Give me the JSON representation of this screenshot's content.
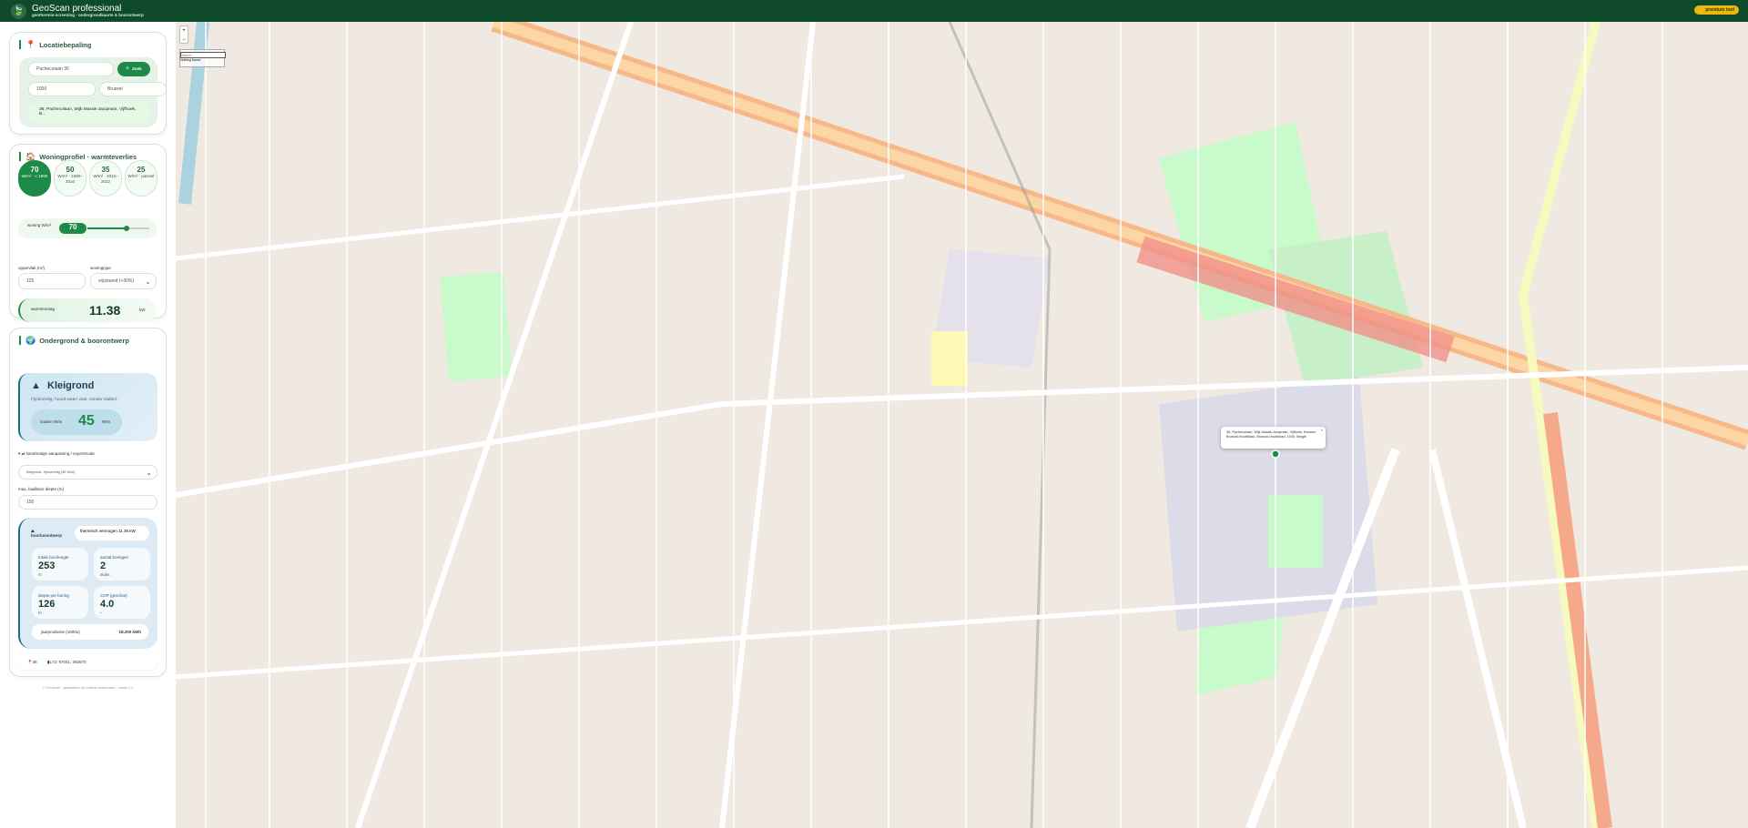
{
  "header": {
    "title": "GeoScan professional",
    "subtitle": "geothermie-screening · ondergrondkaarte & boorontwerp",
    "premium": "👑 premium tool"
  },
  "location": {
    "title": "Locatiebepaling",
    "street": "Pachecolaan 36",
    "search_label": "🔍 Zoek",
    "postcode": "1000",
    "city": "Brussel",
    "result": "36, Pachecolaan, Wijk Marais-Jacqmain, Vijfhoek, B..."
  },
  "profile": {
    "title": "Woningprofiel · warmteverlies",
    "options": [
      {
        "value": "70",
        "label": "W/m² · < 1990"
      },
      {
        "value": "50",
        "label": "W/m² · 1990–2010"
      },
      {
        "value": "35",
        "label": "W/m² · 2010–2022"
      },
      {
        "value": "25",
        "label": "W/m² · passief"
      }
    ],
    "slider_label": "woning W/m²",
    "slider_value": "70",
    "slider_fraction": 0.63,
    "area_label": "oppervlak (m²)",
    "area_value": "125",
    "type_label": "woningtype",
    "type_value": "vrijstaand (+30%)",
    "demand_label": "warmtevraag",
    "demand_value": "11.38",
    "demand_unit": "kW"
  },
  "ground": {
    "title": "Ondergrond & boorontwerp",
    "soil_name": "Kleigrond",
    "soil_desc": "Fijnkorrelig, houdt water vast, minder stabiel.",
    "bodem_label": "bodem W/m",
    "bodem_value": "45",
    "bodem_unit": "W/m",
    "expert_label": "handmatige aanpassing / expertmode",
    "soil_select": "Kleigrond - fijnkorrelig (45 W/m)",
    "depth_label": "max. haalbare diepte (m)",
    "depth_value": "150"
  },
  "design": {
    "title": "boorlusontwerp",
    "capacity": "thermisch vermogen 11.38 kW",
    "stats": [
      {
        "label": "totale boorlengte",
        "value": "253",
        "unit": "m"
      },
      {
        "label": "aantal boringen",
        "value": "2",
        "unit": "stuks"
      },
      {
        "label": "diepte per boring",
        "value": "126",
        "unit": "m"
      },
      {
        "label": "COP (geschat)",
        "value": "4.0",
        "unit": "–"
      }
    ],
    "annual_label": "jaarproductie (1600u)",
    "annual_value": "18.200 kWh"
  },
  "coords": {
    "number": "36",
    "lambert": "L72: 97041, 252570"
  },
  "footer": "© GeoScan · gebaseerd op externe bodemdata · versie 2.0",
  "map": {
    "search_placeholder": "Search...",
    "search_hint": "Nothing found.",
    "popup": "36, Pachecolaan, Wijk Marais-Jacqmain, Vijfhoek, Brussel, Brussel-Hoofdstad, Brussel-Hoofdstad, 1000, België",
    "zoom_in": "+",
    "zoom_out": "−"
  }
}
